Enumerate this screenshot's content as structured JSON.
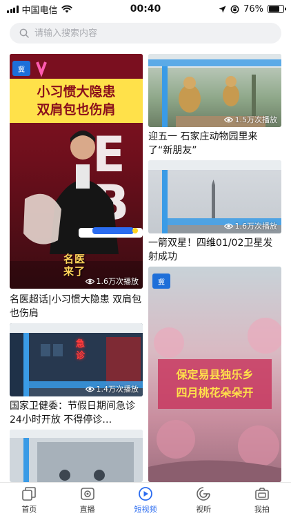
{
  "status_bar": {
    "carrier": "中国电信",
    "time": "00:40",
    "battery": "76%",
    "battery_level": 0.76
  },
  "search": {
    "placeholder": "请输入搜索内容"
  },
  "videos": [
    {
      "title": "名医超话|小习惯大隐患 双肩包也伤肩",
      "plays": "1.6万次播放",
      "thumb_caption": [
        "小习惯大隐患",
        "双肩包也伤肩"
      ],
      "show_badge": "名医来了"
    },
    {
      "title": "迎五一 石家庄动物园里来了“新朋友”",
      "plays": "1.5万次播放"
    },
    {
      "title": "一箭双星！四维01/02卫星发射成功",
      "plays": "1.6万次播放"
    },
    {
      "title": "国家卫健委：节假日期间急诊24小时开放 不得停诊…",
      "plays": "1.4万次播放",
      "thumb_sign": "急诊"
    },
    {
      "title": "",
      "plays": "",
      "thumb_caption": [
        "保定易县独乐乡",
        "四月桃花朵朵开"
      ]
    },
    {
      "title": "",
      "plays": ""
    }
  ],
  "tabs": [
    {
      "label": "首页",
      "icon": "home-icon",
      "active": false
    },
    {
      "label": "直播",
      "icon": "live-icon",
      "active": false
    },
    {
      "label": "短视频",
      "icon": "short-video-icon",
      "active": true
    },
    {
      "label": "视听",
      "icon": "audio-visual-icon",
      "active": false
    },
    {
      "label": "我拍",
      "icon": "camera-icon",
      "active": false
    }
  ],
  "colors": {
    "accent": "#2b6cf0",
    "search_bg": "#f0f1f3",
    "caption_yellow": "#ffe14a"
  }
}
